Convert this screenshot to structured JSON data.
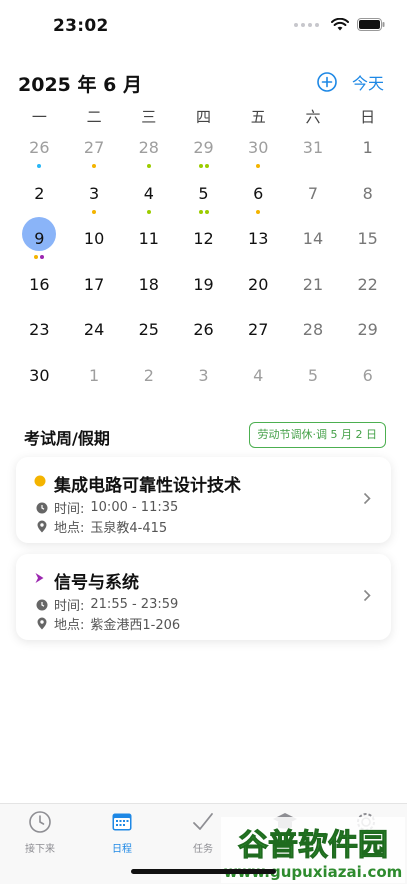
{
  "status": {
    "time": "23:02"
  },
  "header": {
    "month": "2025 年 6 月",
    "today_label": "今天"
  },
  "weekdays": [
    "一",
    "二",
    "三",
    "四",
    "五",
    "六",
    "日"
  ],
  "calendar": {
    "selected": 9,
    "weeks": [
      [
        {
          "d": "26",
          "m": true,
          "dots": [
            "#29b6f6"
          ]
        },
        {
          "d": "27",
          "m": true,
          "dots": [
            "#f4b400"
          ]
        },
        {
          "d": "28",
          "m": true,
          "dots": [
            "#9ccc00"
          ]
        },
        {
          "d": "29",
          "m": true,
          "dots": [
            "#9ccc00",
            "#9ccc00"
          ]
        },
        {
          "d": "30",
          "m": true,
          "dots": [
            "#f4b400"
          ]
        },
        {
          "d": "31",
          "m": true,
          "dots": []
        },
        {
          "d": "1",
          "m": false,
          "w": true,
          "dots": []
        }
      ],
      [
        {
          "d": "2",
          "dots": []
        },
        {
          "d": "3",
          "dots": [
            "#f4b400"
          ]
        },
        {
          "d": "4",
          "dots": [
            "#9ccc00"
          ]
        },
        {
          "d": "5",
          "dots": [
            "#9ccc00",
            "#9ccc00"
          ]
        },
        {
          "d": "6",
          "dots": [
            "#f4b400"
          ]
        },
        {
          "d": "7",
          "w": true,
          "dots": []
        },
        {
          "d": "8",
          "w": true,
          "dots": []
        }
      ],
      [
        {
          "d": "9",
          "sel": true,
          "dots": [
            "#f4b400",
            "#9c27b0"
          ]
        },
        {
          "d": "10",
          "dots": []
        },
        {
          "d": "11",
          "dots": []
        },
        {
          "d": "12",
          "dots": []
        },
        {
          "d": "13",
          "dots": []
        },
        {
          "d": "14",
          "w": true,
          "dots": []
        },
        {
          "d": "15",
          "w": true,
          "dots": []
        }
      ],
      [
        {
          "d": "16",
          "dots": []
        },
        {
          "d": "17",
          "dots": []
        },
        {
          "d": "18",
          "dots": []
        },
        {
          "d": "19",
          "dots": []
        },
        {
          "d": "20",
          "dots": []
        },
        {
          "d": "21",
          "w": true,
          "dots": []
        },
        {
          "d": "22",
          "w": true,
          "dots": []
        }
      ],
      [
        {
          "d": "23",
          "dots": []
        },
        {
          "d": "24",
          "dots": []
        },
        {
          "d": "25",
          "dots": []
        },
        {
          "d": "26",
          "dots": []
        },
        {
          "d": "27",
          "dots": []
        },
        {
          "d": "28",
          "w": true,
          "dots": []
        },
        {
          "d": "29",
          "w": true,
          "dots": []
        }
      ],
      [
        {
          "d": "30",
          "dots": []
        },
        {
          "d": "1",
          "m": true,
          "dots": []
        },
        {
          "d": "2",
          "m": true,
          "dots": []
        },
        {
          "d": "3",
          "m": true,
          "dots": []
        },
        {
          "d": "4",
          "m": true,
          "dots": []
        },
        {
          "d": "5",
          "m": true,
          "dots": []
        },
        {
          "d": "6",
          "m": true,
          "dots": []
        }
      ]
    ]
  },
  "section": {
    "title": "考试周/假期",
    "holiday_badge": "劳动节调休·调 5 月 2 日"
  },
  "events": [
    {
      "title": "集成电路可靠性设计技术",
      "time_label": "时间:",
      "time": "10:00 - 11:35",
      "place_label": "地点:",
      "place": "玉泉教4-415",
      "marker_color": "#f4b400",
      "marker": "dot"
    },
    {
      "title": "信号与系统",
      "time_label": "时间:",
      "time": "21:55 - 23:59",
      "place_label": "地点:",
      "place": "紫金港西1-206",
      "marker_color": "#9c27b0",
      "marker": "chevron"
    }
  ],
  "tabs": [
    {
      "label": "接下来",
      "icon": "clock-icon"
    },
    {
      "label": "日程",
      "icon": "calendar-icon",
      "active": true
    },
    {
      "label": "任务",
      "icon": "check-icon"
    },
    {
      "label": "",
      "icon": "graduation-cap-icon"
    },
    {
      "label": "",
      "icon": "gear-icon"
    }
  ],
  "watermark": {
    "text": "谷普软件园",
    "url": "www.gupuxiazai.com"
  },
  "colors": {
    "accent": "#1e88e5",
    "selected_day": "#8ab4f8",
    "badge_green": "#43a047"
  }
}
